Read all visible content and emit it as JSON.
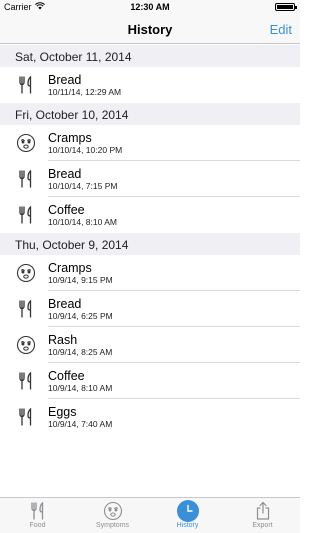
{
  "status_bar": {
    "carrier": "Carrier",
    "time": "12:30 AM"
  },
  "nav": {
    "title": "History",
    "edit_label": "Edit"
  },
  "sections": [
    {
      "header": "Sat, October 11, 2014",
      "rows": [
        {
          "icon": "fork-knife-icon",
          "title": "Bread",
          "time": "10/11/14, 12:29 AM"
        }
      ]
    },
    {
      "header": "Fri, October 10, 2014",
      "rows": [
        {
          "icon": "symptom-face-icon",
          "title": "Cramps",
          "time": "10/10/14, 10:20 PM"
        },
        {
          "icon": "fork-knife-icon",
          "title": "Bread",
          "time": "10/10/14, 7:15 PM"
        },
        {
          "icon": "fork-knife-icon",
          "title": "Coffee",
          "time": "10/10/14, 8:10 AM"
        }
      ]
    },
    {
      "header": "Thu, October 9, 2014",
      "rows": [
        {
          "icon": "symptom-face-icon",
          "title": "Cramps",
          "time": "10/9/14, 9:15 PM"
        },
        {
          "icon": "fork-knife-icon",
          "title": "Bread",
          "time": "10/9/14, 6:25 PM"
        },
        {
          "icon": "symptom-face-icon",
          "title": "Rash",
          "time": "10/9/14, 8:25 AM"
        },
        {
          "icon": "fork-knife-icon",
          "title": "Coffee",
          "time": "10/9/14, 8:10 AM"
        },
        {
          "icon": "fork-knife-icon",
          "title": "Eggs",
          "time": "10/9/14, 7:40 AM"
        }
      ]
    }
  ],
  "tabs": [
    {
      "label": "Food",
      "icon": "fork-knife-icon",
      "active": false
    },
    {
      "label": "Symptoms",
      "icon": "symptom-face-icon",
      "active": false
    },
    {
      "label": "History",
      "icon": "clock-icon",
      "active": true
    },
    {
      "label": "Export",
      "icon": "share-icon",
      "active": false
    }
  ],
  "colors": {
    "accent": "#3a8fd9",
    "section_bg": "#efeff4",
    "bar_bg": "#f8f8f8"
  }
}
